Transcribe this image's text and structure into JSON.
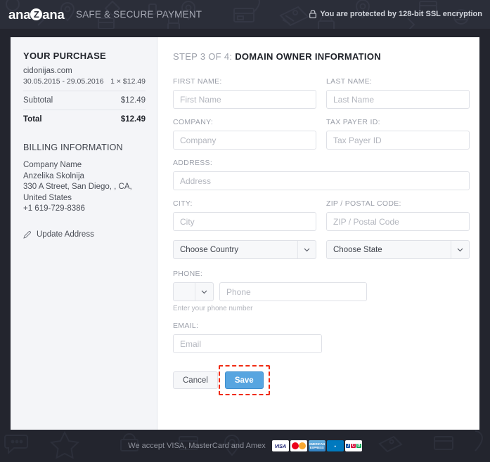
{
  "header": {
    "logo_text_1": "ana",
    "logo_badge": "Z",
    "logo_text_2": "ana",
    "tagline": "SAFE & SECURE PAYMENT",
    "ssl_notice": "You are protected by 128-bit SSL encryption",
    "lock_icon": "lock-icon"
  },
  "sidebar": {
    "purchase_title": "YOUR PURCHASE",
    "domain": "cidonijas.com",
    "period": "30.05.2015 - 29.05.2016",
    "quantity_price": "1 × $12.49",
    "subtotal_label": "Subtotal",
    "subtotal_value": "$12.49",
    "total_label": "Total",
    "total_value": "$12.49",
    "billing_title": "BILLING INFORMATION",
    "billing_lines": [
      "Company Name",
      "Anzelika Skolnija",
      "330 A Street, San Diego, , CA, United States",
      "+1 619-729-8386"
    ],
    "update_address_label": "Update Address",
    "pencil_icon": "pencil-icon"
  },
  "form": {
    "step_prefix": "STEP 3 OF 4: ",
    "step_title": "DOMAIN OWNER INFORMATION",
    "fields": {
      "first_name": {
        "label": "FIRST NAME:",
        "placeholder": "First Name",
        "value": ""
      },
      "last_name": {
        "label": "LAST NAME:",
        "placeholder": "Last Name",
        "value": ""
      },
      "company": {
        "label": "COMPANY:",
        "placeholder": "Company",
        "value": ""
      },
      "tax_payer_id": {
        "label": "TAX PAYER ID:",
        "placeholder": "Tax Payer ID",
        "value": ""
      },
      "address": {
        "label": "ADDRESS:",
        "placeholder": "Address",
        "value": ""
      },
      "city": {
        "label": "CITY:",
        "placeholder": "City",
        "value": ""
      },
      "zip": {
        "label": "ZIP / POSTAL CODE:",
        "placeholder": "ZIP / Postal Code",
        "value": ""
      },
      "country": {
        "selected": "Choose Country"
      },
      "state": {
        "selected": "Choose State"
      },
      "phone": {
        "label": "PHONE:",
        "country_code_selected": "",
        "placeholder": "Phone",
        "value": "",
        "help": "Enter your phone number"
      },
      "email": {
        "label": "EMAIL:",
        "placeholder": "Email",
        "value": ""
      }
    },
    "cancel_label": "Cancel",
    "save_label": "Save",
    "chevron_icon": "chevron-down-icon"
  },
  "footer": {
    "text": "We accept VISA, MasterCard and Amex",
    "cards": [
      "VISA",
      "MasterCard",
      "AMERICAN EXPRESS",
      "Diners Club",
      "JCB"
    ]
  },
  "colors": {
    "header_bg": "#2b2e39",
    "page_bg": "#23252e",
    "sidebar_bg": "#f4f5f8",
    "save_button": "#57a5e0",
    "highlight": "#f02b12"
  }
}
